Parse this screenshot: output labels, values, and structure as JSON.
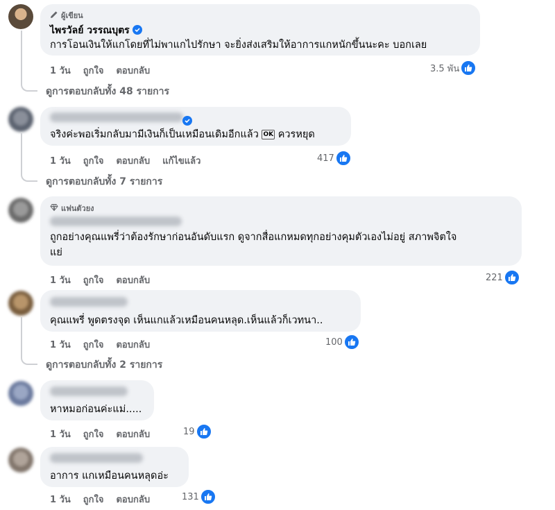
{
  "colors": {
    "accent": "#1877f2",
    "bubble": "#f0f2f5",
    "meta": "#65676b"
  },
  "comments": [
    {
      "badge": "ผู้เขียน",
      "name": "ไพรวัลย์ วรรณบุตร",
      "text": "การโอนเงินให้แกโดยที่ไม่พาแกไปรักษา จะยิ่งส่งเสริมให้อาการแกหนักขึ้นนะคะ บอกเลย",
      "time": "1 วัน",
      "like": "ถูกใจ",
      "reply": "ตอบกลับ",
      "reactions": "3.5 พัน",
      "view_replies": "ดูการตอบกลับทั้ง 48 รายการ"
    },
    {
      "text_a": "จริงค่ะพอเริ่มกลับมามีเงินก็เป็นเหมือนเดิมอีกแล้ว",
      "emoji": "OK",
      "text_b": "ควรหยุด",
      "time": "1 วัน",
      "like": "ถูกใจ",
      "reply": "ตอบกลับ",
      "edited": "แก้ไขแล้ว",
      "reactions": "417",
      "view_replies": "ดูการตอบกลับทั้ง 7 รายการ"
    },
    {
      "badge": "แฟนตัวยง",
      "text_line1": "ถูกอย่างคุณแพรี่ว่าต้องรักษาก่อนอันดับแรก ดูจากสื่อแกหมดทุกอย่างคุมตัวเองไม่อยู่ สภาพจิตใจ",
      "text_line2": "แย่",
      "time": "1 วัน",
      "like": "ถูกใจ",
      "reply": "ตอบกลับ",
      "reactions": "221"
    },
    {
      "text": "คุณแพรี่ พูดตรงจุด เห็นแกแล้วเหมือนคนหลุด.เห็นแล้วก็เวทนา..",
      "time": "1 วัน",
      "like": "ถูกใจ",
      "reply": "ตอบกลับ",
      "reactions": "100",
      "view_replies": "ดูการตอบกลับทั้ง 2 รายการ"
    },
    {
      "text": "หาหมอก่อนค่ะแม่.....",
      "time": "1 วัน",
      "like": "ถูกใจ",
      "reply": "ตอบกลับ",
      "reactions": "19"
    },
    {
      "text": "อาการ แกเหมือนคนหลุดอ่ะ",
      "time": "1 วัน",
      "like": "ถูกใจ",
      "reply": "ตอบกลับ",
      "reactions": "131"
    }
  ]
}
